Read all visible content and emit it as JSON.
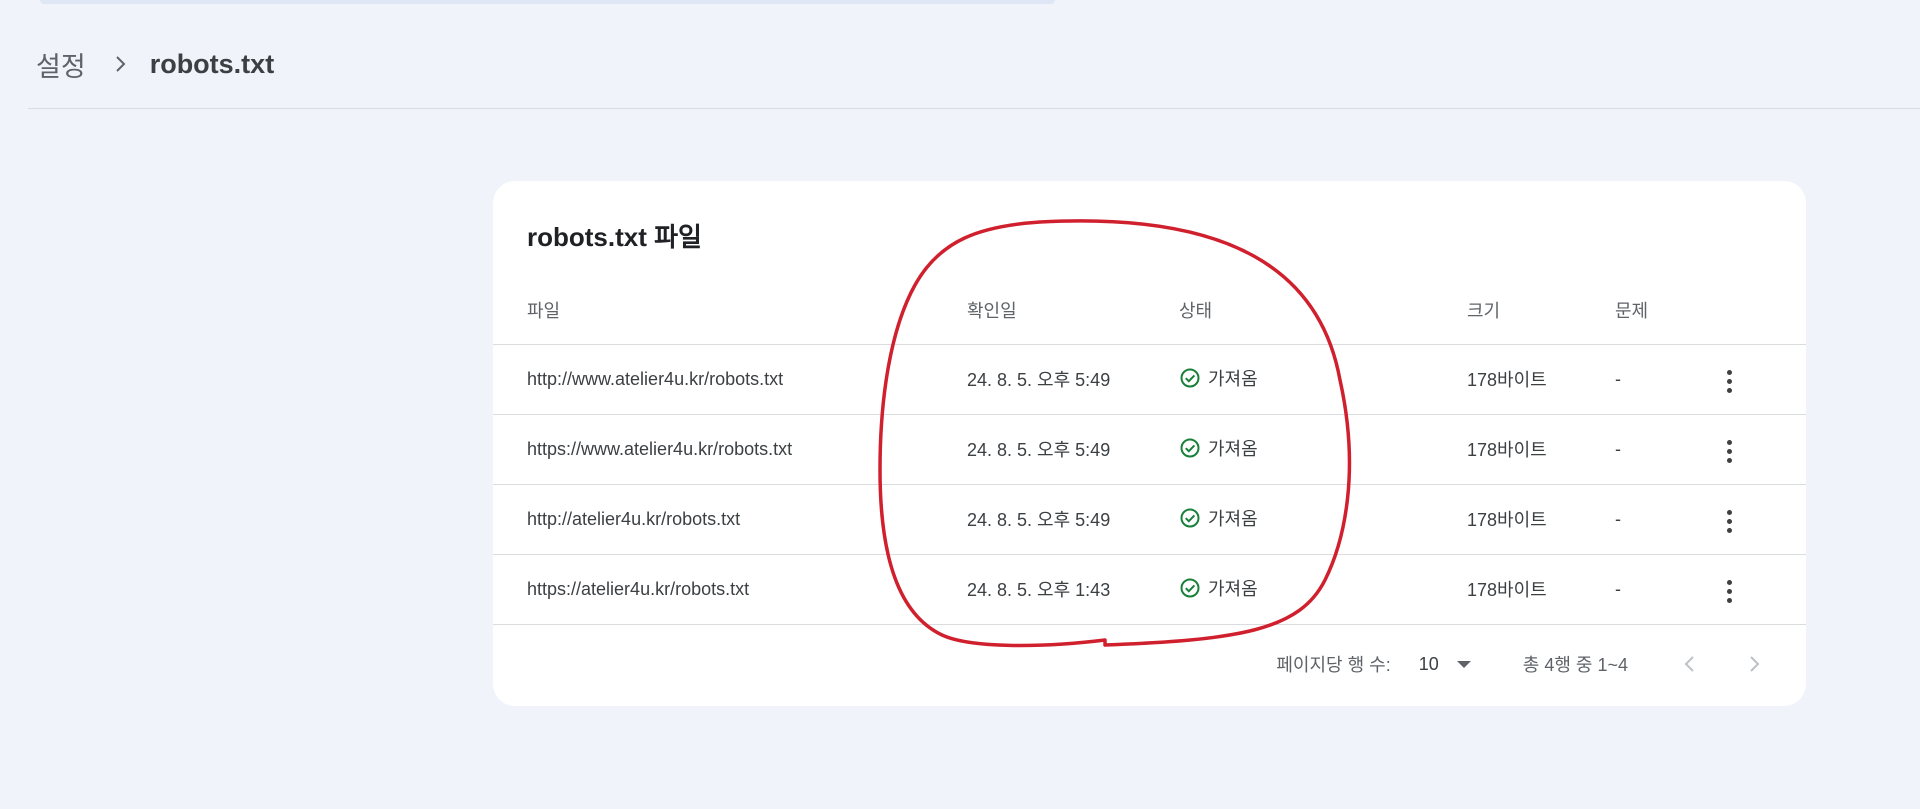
{
  "breadcrumb": {
    "parent": "설정",
    "current": "robots.txt"
  },
  "card": {
    "title": "robots.txt 파일"
  },
  "table": {
    "headers": {
      "file": "파일",
      "date": "확인일",
      "status": "상태",
      "size": "크기",
      "issues": "문제"
    },
    "rows": [
      {
        "file": "http://www.atelier4u.kr/robots.txt",
        "date": "24. 8. 5. 오후 5:49",
        "status": "가져옴",
        "size": "178바이트",
        "issues": "-"
      },
      {
        "file": "https://www.atelier4u.kr/robots.txt",
        "date": "24. 8. 5. 오후 5:49",
        "status": "가져옴",
        "size": "178바이트",
        "issues": "-"
      },
      {
        "file": "http://atelier4u.kr/robots.txt",
        "date": "24. 8. 5. 오후 5:49",
        "status": "가져옴",
        "size": "178바이트",
        "issues": "-"
      },
      {
        "file": "https://atelier4u.kr/robots.txt",
        "date": "24. 8. 5. 오후 1:43",
        "status": "가져옴",
        "size": "178바이트",
        "issues": "-"
      }
    ]
  },
  "pagination": {
    "rows_per_page_label": "페이지당 행 수:",
    "rows_per_page_value": "10",
    "range_text": "총 4행 중 1~4"
  },
  "icons": {
    "status": "check-circle-icon",
    "row_menu": "more-vert-icon",
    "prev": "chevron-left-icon",
    "next": "chevron-right-icon",
    "breadcrumb_sep": "chevron-right-icon"
  },
  "colors": {
    "background": "#f0f3f9",
    "card": "#ffffff",
    "status_ok": "#188038",
    "annotation": "#d0202e"
  }
}
